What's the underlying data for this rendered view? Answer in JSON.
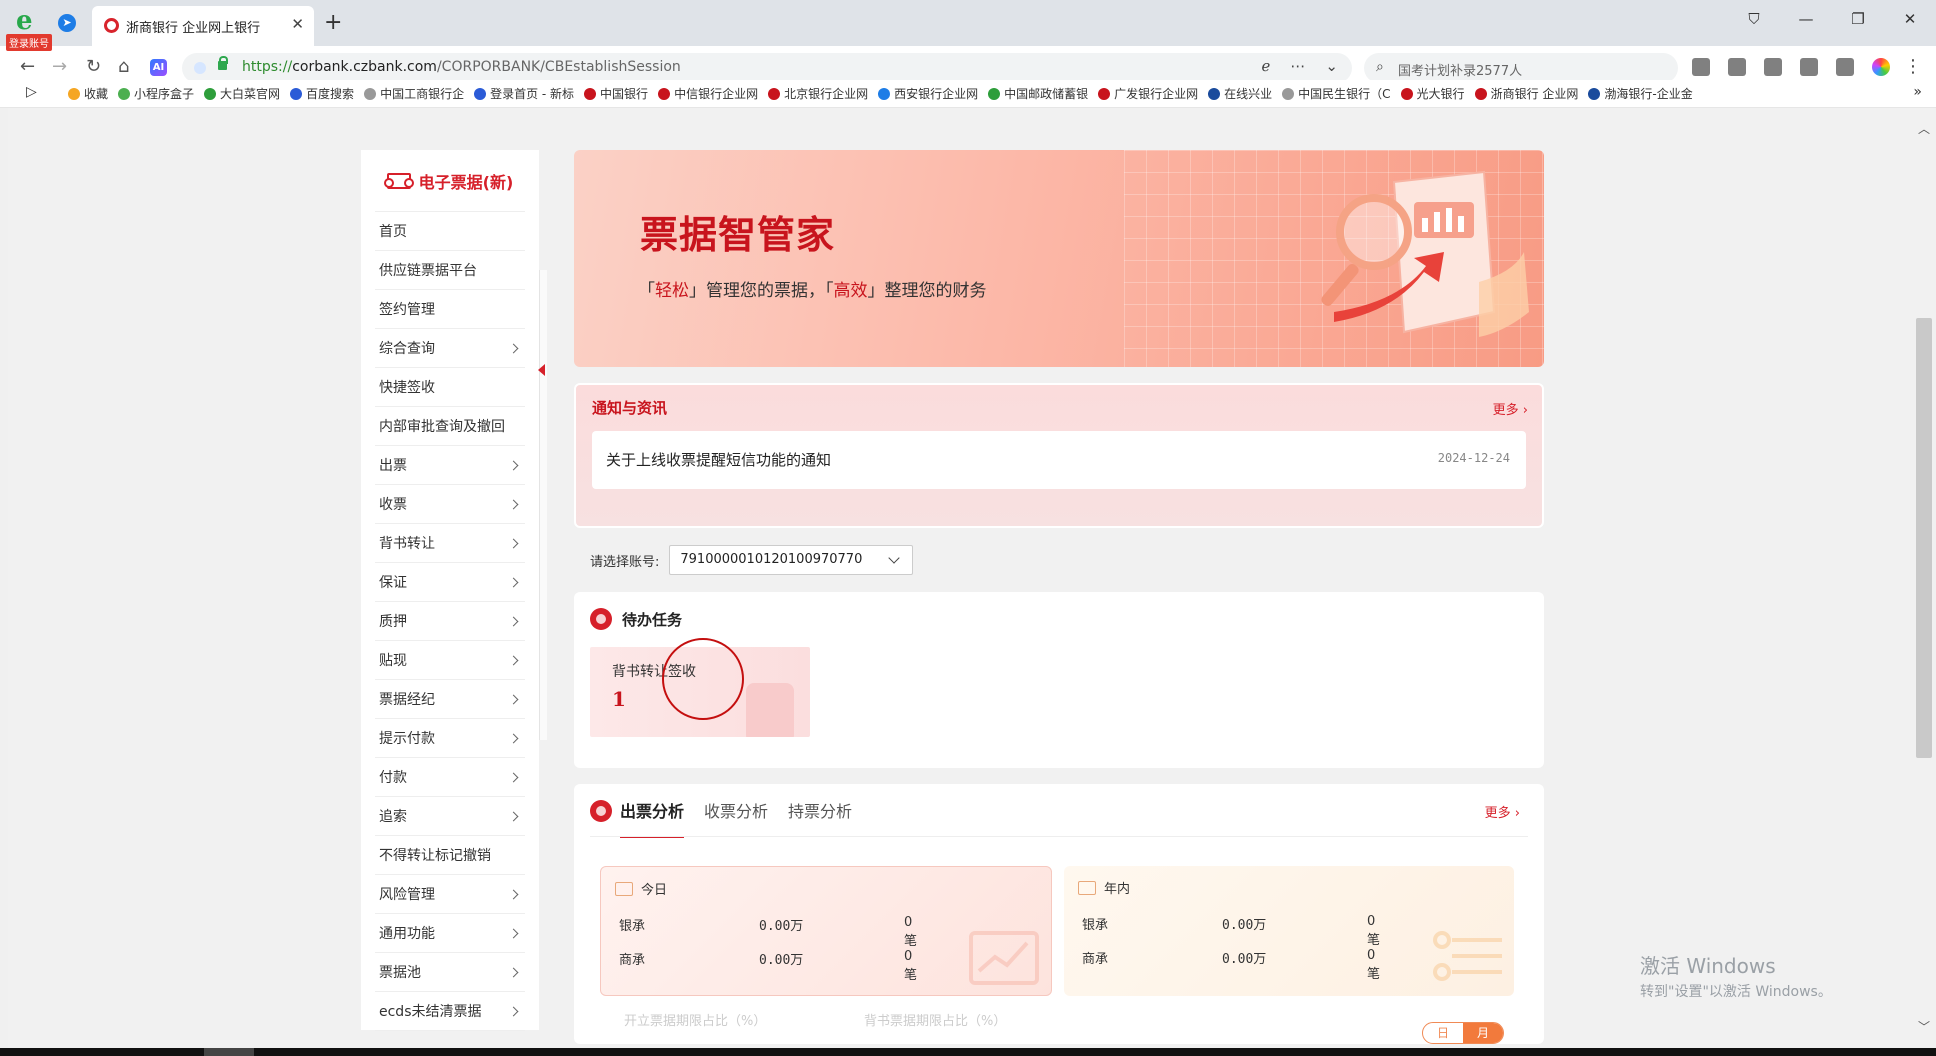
{
  "browser": {
    "login_badge": "登录账号",
    "tab_title": "浙商银行 企业网上银行",
    "tab_close": "✕",
    "new_tab": "+",
    "url_scheme": "https://",
    "url_host": "corbank.czbank.com",
    "url_path": "/CORPORBANK/CBEstablishSession",
    "search_text": "国考计划补录2577人",
    "window_controls": [
      "⛉",
      "—",
      "❐",
      "✕"
    ],
    "bookmarks": [
      {
        "label": "收藏",
        "color": "#f5a623"
      },
      {
        "label": "小程序盒子",
        "color": "#4caf50"
      },
      {
        "label": "大白菜官网",
        "color": "#2e9e3b"
      },
      {
        "label": "百度搜索",
        "color": "#2b5bd7"
      },
      {
        "label": "中国工商银行企",
        "color": "#999999"
      },
      {
        "label": "登录首页 - 新标",
        "color": "#2b5bd7"
      },
      {
        "label": "中国银行",
        "color": "#c8141d"
      },
      {
        "label": "中信银行企业网",
        "color": "#c8141d"
      },
      {
        "label": "北京银行企业网",
        "color": "#c8141d"
      },
      {
        "label": "西安银行企业网",
        "color": "#1e7de6"
      },
      {
        "label": "中国邮政储蓄银",
        "color": "#2e9e3b"
      },
      {
        "label": "广发银行企业网",
        "color": "#c8141d"
      },
      {
        "label": "在线兴业",
        "color": "#1a4b9c"
      },
      {
        "label": "中国民生银行（C",
        "color": "#999999"
      },
      {
        "label": "光大银行",
        "color": "#c8141d"
      },
      {
        "label": "浙商银行 企业网",
        "color": "#c8141d"
      },
      {
        "label": "渤海银行-企业金",
        "color": "#1a4b9c"
      }
    ]
  },
  "sidebar": {
    "title": "电子票据(新)",
    "items": [
      {
        "label": "首页",
        "chevron": false
      },
      {
        "label": "供应链票据平台",
        "chevron": false
      },
      {
        "label": "签约管理",
        "chevron": false
      },
      {
        "label": "综合查询",
        "chevron": true
      },
      {
        "label": "快捷签收",
        "chevron": false
      },
      {
        "label": "内部审批查询及撤回",
        "chevron": false
      },
      {
        "label": "出票",
        "chevron": true
      },
      {
        "label": "收票",
        "chevron": true
      },
      {
        "label": "背书转让",
        "chevron": true
      },
      {
        "label": "保证",
        "chevron": true
      },
      {
        "label": "质押",
        "chevron": true
      },
      {
        "label": "贴现",
        "chevron": true
      },
      {
        "label": "票据经纪",
        "chevron": true
      },
      {
        "label": "提示付款",
        "chevron": true
      },
      {
        "label": "付款",
        "chevron": true
      },
      {
        "label": "追索",
        "chevron": true
      },
      {
        "label": "不得转让标记撤销",
        "chevron": false
      },
      {
        "label": "风险管理",
        "chevron": true
      },
      {
        "label": "通用功能",
        "chevron": true
      },
      {
        "label": "票据池",
        "chevron": true
      },
      {
        "label": "ecds未结清票据",
        "chevron": true
      }
    ]
  },
  "banner": {
    "title": "票据智管家",
    "sub_q1_open": "「",
    "sub_hl1": "轻松",
    "sub_q1_close": "」",
    "sub_mid": "管理您的票据，",
    "sub_q2_open": "「",
    "sub_hl2": "高效",
    "sub_q2_close": "」",
    "sub_end": "整理您的财务"
  },
  "notice": {
    "title": "通知与资讯",
    "more": "更多 ›",
    "item_title": "关于上线收票提醒短信功能的通知",
    "item_date": "2024-12-24"
  },
  "account": {
    "label": "请选择账号:",
    "value": "7910000010120100970770"
  },
  "todo": {
    "title": "待办任务",
    "card_label": "背书转让签收",
    "card_count": "1"
  },
  "analysis": {
    "tabs": [
      "出票分析",
      "收票分析",
      "持票分析"
    ],
    "active_tab": 0,
    "more": "更多 ›",
    "today": {
      "title": "今日",
      "rows": [
        {
          "type": "银承",
          "amount": "0.00万",
          "count": "0笔"
        },
        {
          "type": "商承",
          "amount": "0.00万",
          "count": "0笔"
        }
      ]
    },
    "year": {
      "title": "年内",
      "rows": [
        {
          "type": "银承",
          "amount": "0.00万",
          "count": "0笔"
        },
        {
          "type": "商承",
          "amount": "0.00万",
          "count": "0笔"
        }
      ]
    },
    "ratio_labels": [
      "开立票据期限占比（%）",
      "背书票据期限占比（%）"
    ],
    "toggle": [
      "日",
      "月"
    ],
    "toggle_active": 1
  },
  "watermark": {
    "line1": "激活 Windows",
    "line2": "转到\"设置\"以激活 Windows。"
  },
  "colors": {
    "brand_red": "#d6202a",
    "banner_title": "#c8141d",
    "toggle_orange": "#f27a3c"
  }
}
